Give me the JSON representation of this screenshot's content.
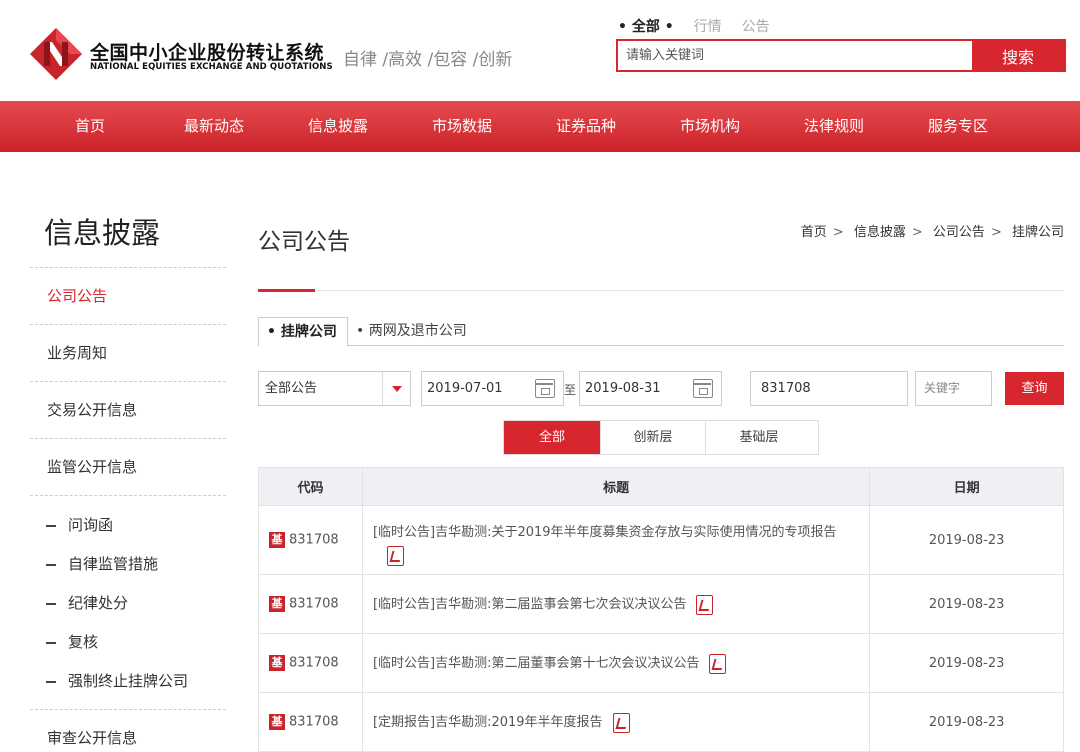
{
  "header": {
    "logo_cn": "全国中小企业股份转让系统",
    "logo_en": "NATIONAL EQUITIES EXCHANGE AND QUOTATIONS",
    "slogan": "自律 /高效 /包容 /创新",
    "search_tabs": [
      "• 全部 •",
      "行情",
      "公告"
    ],
    "search_placeholder": "请输入关键词",
    "search_button": "搜索"
  },
  "nav": [
    "首页",
    "最新动态",
    "信息披露",
    "市场数据",
    "证券品种",
    "市场机构",
    "法律规则",
    "服务专区"
  ],
  "sidebar": {
    "title": "信息披露",
    "items": [
      "公司公告",
      "业务周知",
      "交易公开信息",
      "监管公开信息"
    ],
    "sub_items": [
      "问询函",
      "自律监管措施",
      "纪律处分",
      "复核",
      "强制终止挂牌公司"
    ],
    "last_item": "审查公开信息"
  },
  "main": {
    "title": "公司公告",
    "breadcrumb": [
      "首页",
      "信息披露",
      "公司公告",
      "挂牌公司"
    ],
    "subtabs": [
      "• 挂牌公司",
      "• 两网及退市公司"
    ],
    "filters": {
      "type_select": "全部公告",
      "date_from": "2019-07-01",
      "date_sep": "至",
      "date_to": "2019-08-31",
      "code": "831708",
      "keyword_placeholder": "关键字",
      "query_button": "查询"
    },
    "levels": [
      "全部",
      "创新层",
      "基础层"
    ],
    "table": {
      "headers": [
        "代码",
        "标题",
        "日期"
      ],
      "badge": "基",
      "rows": [
        {
          "code": "831708",
          "title": "[临时公告]吉华勘测:关于2019年半年度募集资金存放与实际使用情况的专项报告",
          "date": "2019-08-23"
        },
        {
          "code": "831708",
          "title": "[临时公告]吉华勘测:第二届监事会第七次会议决议公告",
          "date": "2019-08-23"
        },
        {
          "code": "831708",
          "title": "[临时公告]吉华勘测:第二届董事会第十七次会议决议公告",
          "date": "2019-08-23"
        },
        {
          "code": "831708",
          "title": "[定期报告]吉华勘测:2019年半年度报告",
          "date": "2019-08-23"
        }
      ]
    }
  },
  "colors": {
    "brand_red": "#d7262e",
    "header_bg": "#eef0f4"
  }
}
